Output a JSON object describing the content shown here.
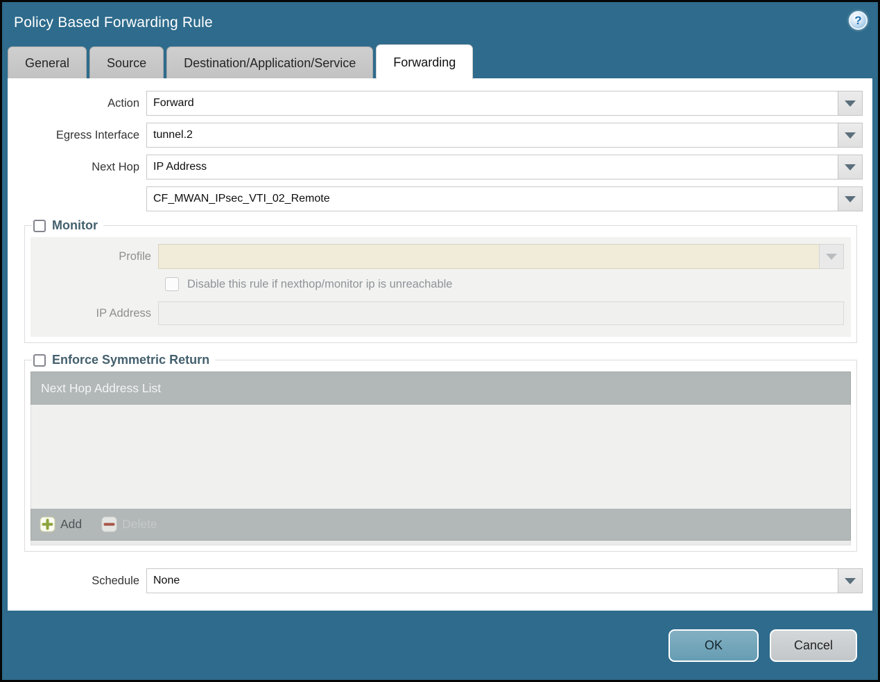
{
  "window": {
    "title": "Policy Based Forwarding Rule"
  },
  "icons": {
    "help_glyph": "?"
  },
  "tabs": [
    {
      "label": "General",
      "active": false
    },
    {
      "label": "Source",
      "active": false
    },
    {
      "label": "Destination/Application/Service",
      "active": false
    },
    {
      "label": "Forwarding",
      "active": true
    }
  ],
  "form": {
    "action": {
      "label": "Action",
      "value": "Forward"
    },
    "egress_interface": {
      "label": "Egress Interface",
      "value": "tunnel.2"
    },
    "next_hop": {
      "label": "Next Hop",
      "value": "IP Address"
    },
    "next_hop_address": {
      "label": "",
      "value": "CF_MWAN_IPsec_VTI_02_Remote"
    },
    "schedule": {
      "label": "Schedule",
      "value": "None"
    }
  },
  "monitor": {
    "legend": "Monitor",
    "checked": false,
    "profile": {
      "label": "Profile",
      "value": ""
    },
    "disable_rule": {
      "label": "Disable this rule if nexthop/monitor ip is unreachable",
      "checked": false
    },
    "ip_address": {
      "label": "IP Address",
      "value": ""
    }
  },
  "symmetric_return": {
    "legend": "Enforce Symmetric Return",
    "checked": false,
    "table": {
      "header": "Next Hop Address List",
      "rows": []
    },
    "add_label": "Add",
    "delete_label": "Delete"
  },
  "footer": {
    "ok_label": "OK",
    "cancel_label": "Cancel"
  },
  "colors": {
    "titlebar": "#2e6b8c",
    "tab_inactive": "#c6c6c6",
    "table_gray": "#b2b7b8",
    "disabled_beige": "#f1ebd9",
    "ok_button": "#6fa6bb",
    "legend_text": "#44606e"
  }
}
